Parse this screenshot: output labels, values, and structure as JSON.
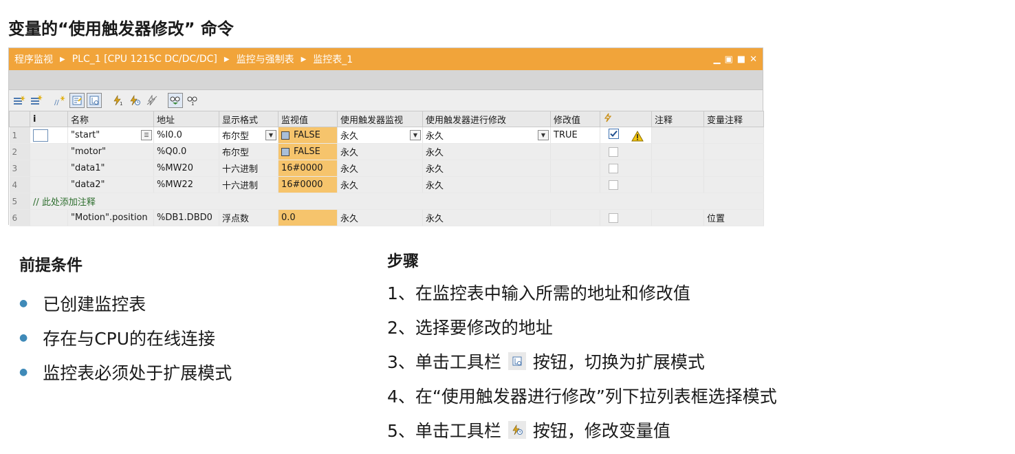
{
  "page_title": "变量的“使用触发器修改” 命令",
  "window": {
    "breadcrumb": [
      "程序监视",
      "PLC_1 [CPU 1215C DC/DC/DC]",
      "监控与强制表",
      "监控表_1"
    ],
    "controls": [
      "minimize",
      "restore",
      "maximize",
      "close"
    ]
  },
  "toolbar_icons": [
    {
      "name": "insert-row-icon"
    },
    {
      "name": "add-row-icon"
    },
    {
      "name": "insert-comment-row-icon"
    },
    {
      "name": "show-basic-mode-icon",
      "active": true
    },
    {
      "name": "show-extended-mode-icon",
      "active": true
    },
    {
      "name": "modify-now-icon"
    },
    {
      "name": "modify-with-trigger-icon"
    },
    {
      "name": "enable-peripheral-outputs-icon"
    },
    {
      "name": "monitor-all-icon",
      "active": true
    },
    {
      "name": "monitor-now-icon"
    }
  ],
  "table": {
    "columns": [
      "i",
      "名称",
      "地址",
      "显示格式",
      "监视值",
      "使用触发器监视",
      "使用触发器进行修改",
      "修改值",
      "",
      "注释",
      "变量注释"
    ],
    "rows": [
      {
        "num": "1",
        "name": "\"start\"",
        "address": "%I0.0",
        "format": "布尔型",
        "monitor": "FALSE",
        "trigger_monitor": "永久",
        "trigger_modify": "永久",
        "modify_value": "TRUE",
        "checked": true,
        "warning": true,
        "comment": "",
        "var_comment": ""
      },
      {
        "num": "2",
        "name": "\"motor\"",
        "address": "%Q0.0",
        "format": "布尔型",
        "monitor": "FALSE",
        "trigger_monitor": "永久",
        "trigger_modify": "永久",
        "modify_value": "",
        "checked": false,
        "warning": false,
        "comment": "",
        "var_comment": ""
      },
      {
        "num": "3",
        "name": "\"data1\"",
        "address": "%MW20",
        "format": "十六进制",
        "monitor": "16#0000",
        "trigger_monitor": "永久",
        "trigger_modify": "永久",
        "modify_value": "",
        "checked": false,
        "warning": false,
        "comment": "",
        "var_comment": ""
      },
      {
        "num": "4",
        "name": "\"data2\"",
        "address": "%MW22",
        "format": "十六进制",
        "monitor": "16#0000",
        "trigger_monitor": "永久",
        "trigger_modify": "永久",
        "modify_value": "",
        "checked": false,
        "warning": false,
        "comment": "",
        "var_comment": ""
      },
      {
        "num": "5",
        "comment_row": "// 此处添加注释"
      },
      {
        "num": "6",
        "name": "\"Motion\".position",
        "address": "%DB1.DBD0",
        "format": "浮点数",
        "monitor": "0.0",
        "trigger_monitor": "永久",
        "trigger_modify": "永久",
        "modify_value": "",
        "checked": false,
        "warning": false,
        "comment": "",
        "var_comment": "位置"
      }
    ]
  },
  "prereq": {
    "title": "前提条件",
    "items": [
      "已创建监控表",
      "存在与CPU的在线连接",
      "监控表必须处于扩展模式"
    ]
  },
  "steps": {
    "title": "步骤",
    "items": [
      {
        "prefix": "1、在监控表中输入所需的地址和修改值",
        "icon": "",
        "suffix": ""
      },
      {
        "prefix": "2、选择要修改的地址",
        "icon": "",
        "suffix": ""
      },
      {
        "prefix": "3、单击工具栏",
        "icon": "show-extended-mode-icon",
        "suffix": "按钮，切换为扩展模式"
      },
      {
        "prefix": "4、在“使用触发器进行修改”列下拉列表框选择模式",
        "icon": "",
        "suffix": ""
      },
      {
        "prefix": "5、单击工具栏",
        "icon": "modify-with-trigger-icon",
        "suffix": "按钮，修改变量值"
      }
    ]
  },
  "colors": {
    "titlebar": "#f1a43a",
    "monitor_cell": "#f6c46c",
    "bullet": "#3f8ab8",
    "comment_text": "#2e6e2e"
  }
}
